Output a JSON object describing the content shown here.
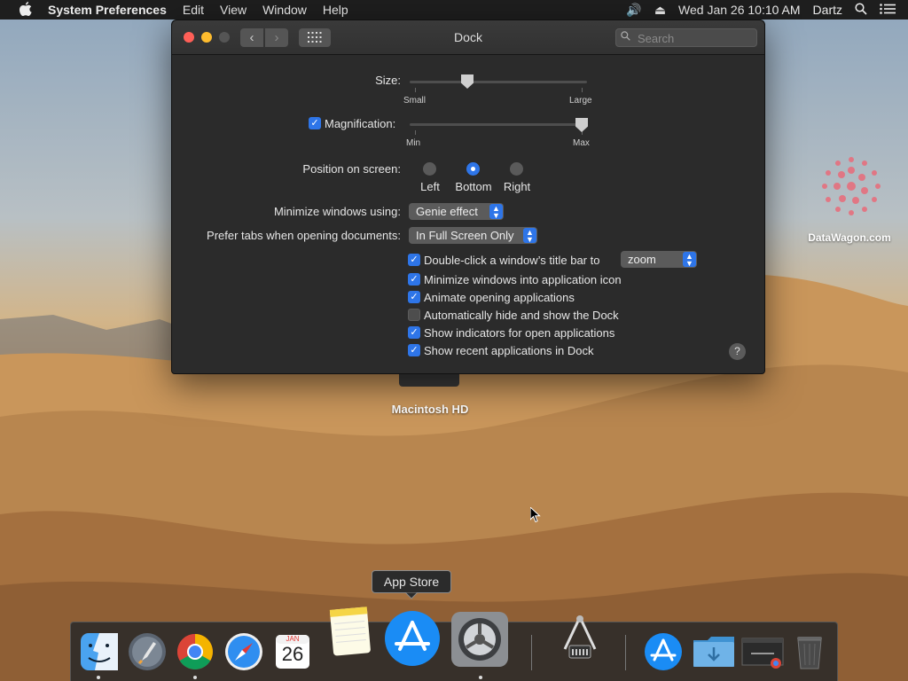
{
  "menubar": {
    "apple_icon": "apple-logo-icon",
    "app_name": "System Preferences",
    "menus": [
      "Edit",
      "View",
      "Window",
      "Help"
    ],
    "date_time": "Wed Jan 26  10:10 AM",
    "user": "Dartz"
  },
  "window": {
    "title": "Dock",
    "search_placeholder": "Search",
    "size": {
      "label": "Size:",
      "min_label": "Small",
      "max_label": "Large",
      "value_fraction": 0.33
    },
    "magnification": {
      "label": "Magnification:",
      "checked": true,
      "min_label": "Min",
      "max_label": "Max",
      "value_fraction": 1.0
    },
    "position": {
      "label": "Position on screen:",
      "options": [
        "Left",
        "Bottom",
        "Right"
      ],
      "selected": "Bottom"
    },
    "minimize_using": {
      "label": "Minimize windows using:",
      "value": "Genie effect"
    },
    "prefer_tabs": {
      "label": "Prefer tabs when opening documents:",
      "value": "In Full Screen Only"
    },
    "double_click": {
      "label": "Double-click a window’s title bar to",
      "value": "zoom",
      "checked": true
    },
    "checkboxes": [
      {
        "label": "Minimize windows into application icon",
        "checked": true
      },
      {
        "label": "Animate opening applications",
        "checked": true
      },
      {
        "label": "Automatically hide and show the Dock",
        "checked": false
      },
      {
        "label": "Show indicators for open applications",
        "checked": true
      },
      {
        "label": "Show recent applications in Dock",
        "checked": true
      }
    ],
    "help_label": "?"
  },
  "desktop": {
    "hd_label": "Macintosh HD",
    "watermark": "DataWagon.com"
  },
  "tooltip": "App Store",
  "dock": {
    "items": [
      "Finder",
      "Launchpad",
      "Chrome",
      "Safari",
      "Calendar",
      "Notes",
      "App Store",
      "System Preferences",
      "Utility",
      "App Store (recent)",
      "Downloads",
      "Chrome Window",
      "Trash"
    ],
    "calendar_month": "JAN",
    "calendar_day": "26"
  }
}
